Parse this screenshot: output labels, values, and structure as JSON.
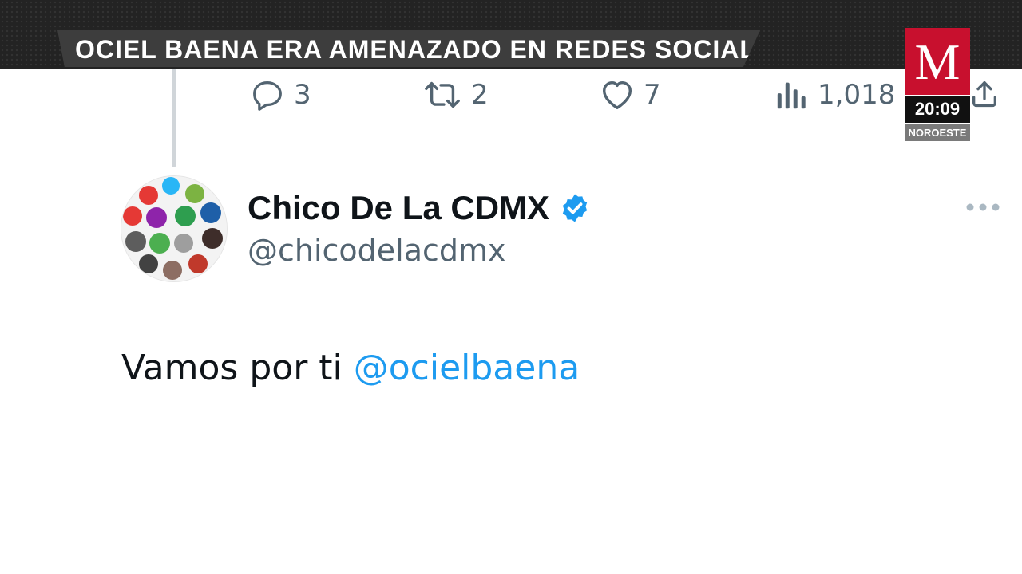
{
  "broadcast": {
    "headline": "OCIEL BAENA ERA AMENAZADO EN REDES SOCIALES",
    "logo_letter": "M",
    "time": "20:09",
    "region": "NOROESTE",
    "colors": {
      "brand_red": "#c8102e",
      "band": "#232323",
      "headline_bg": "#3d3d3d"
    }
  },
  "tweet_actions": {
    "replies": "3",
    "retweets": "2",
    "likes": "7",
    "views": "1,018",
    "icons": [
      "reply-icon",
      "retweet-icon",
      "like-icon",
      "views-icon",
      "share-icon"
    ]
  },
  "tweet": {
    "display_name": "Chico De La CDMX",
    "verified": true,
    "handle": "@chicodelacdmx",
    "text": "Vamos por ti ",
    "mention": "@ocielbaena",
    "colors": {
      "text": "#0f1419",
      "secondary": "#536471",
      "link": "#1d9bf0",
      "verified": "#1d9bf0"
    }
  }
}
